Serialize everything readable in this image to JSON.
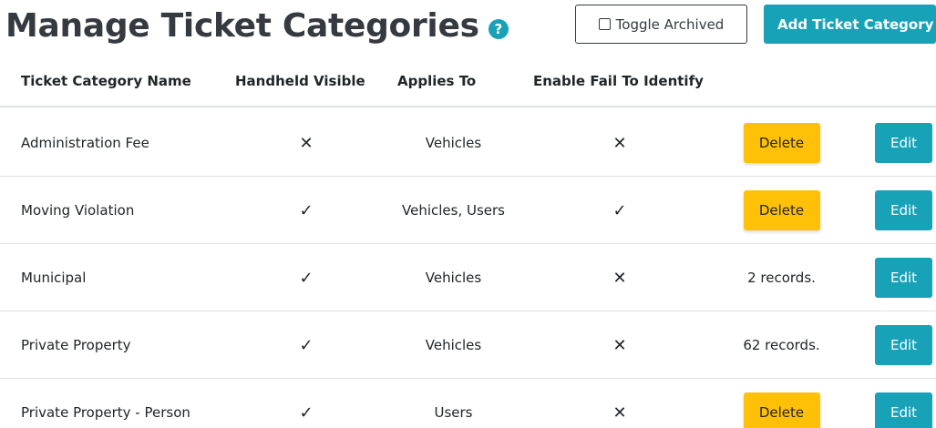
{
  "header": {
    "title": "Manage Ticket Categories",
    "help_glyph": "?",
    "toggle_archived_label": "Toggle Archived",
    "add_label": "Add Ticket Category"
  },
  "table": {
    "columns": [
      "Ticket Category Name",
      "Handheld Visible",
      "Applies To",
      "Enable Fail To Identify"
    ],
    "rows": [
      {
        "name": "Administration Fee",
        "handheld": "✕",
        "handheld_state": "no",
        "applies": "Vehicles",
        "fail": "✕",
        "fail_state": "no",
        "action": "Delete",
        "action_type": "button",
        "edit": "Edit"
      },
      {
        "name": "Moving Violation",
        "handheld": "✓",
        "handheld_state": "yes",
        "applies": "Vehicles, Users",
        "fail": "✓",
        "fail_state": "yes",
        "action": "Delete",
        "action_type": "button",
        "edit": "Edit"
      },
      {
        "name": "Municipal",
        "handheld": "✓",
        "handheld_state": "yes",
        "applies": "Vehicles",
        "fail": "✕",
        "fail_state": "no",
        "action": "2 records.",
        "action_type": "text",
        "edit": "Edit"
      },
      {
        "name": "Private Property",
        "handheld": "✓",
        "handheld_state": "yes",
        "applies": "Vehicles",
        "fail": "✕",
        "fail_state": "no",
        "action": "62 records.",
        "action_type": "text",
        "edit": "Edit"
      },
      {
        "name": "Private Property - Person",
        "handheld": "✓",
        "handheld_state": "yes",
        "applies": "Users",
        "fail": "✕",
        "fail_state": "no",
        "action": "Delete",
        "action_type": "button",
        "edit": "Edit"
      }
    ]
  },
  "colors": {
    "primary": "#17a2b8",
    "warning": "#ffc107",
    "text": "#212529"
  }
}
